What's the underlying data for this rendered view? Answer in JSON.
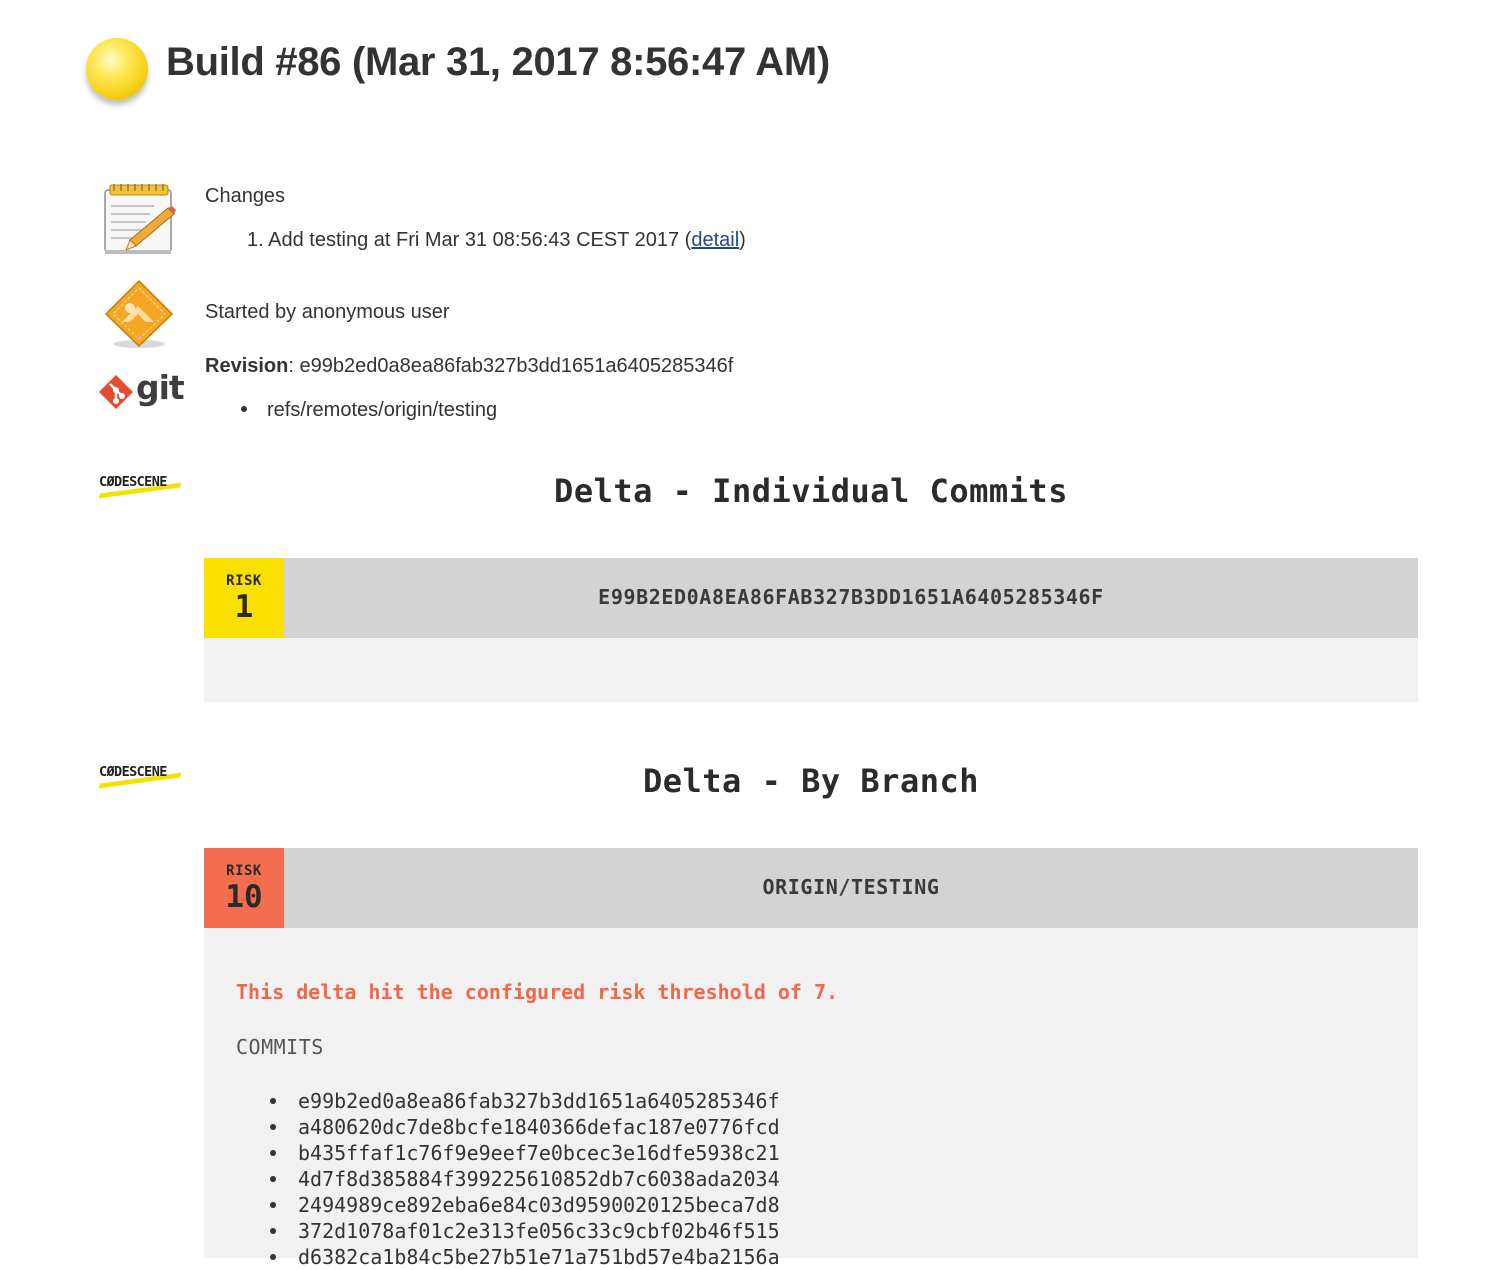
{
  "build": {
    "title": "Build #86 (Mar 31, 2017 8:56:47 AM)",
    "status_color": "#f6cf19"
  },
  "changes": {
    "heading": "Changes",
    "items": [
      {
        "number": "1.",
        "text": "Add testing at Fri Mar 31 08:56:43 CEST 2017",
        "link_label": "detail"
      }
    ]
  },
  "cause": {
    "text": "Started by anonymous user"
  },
  "git": {
    "logo_text": "git",
    "revision_label": "Revision",
    "revision_value": ": e99b2ed0a8ea86fab327b3dd1651a6405285346f",
    "branches": [
      "refs/remotes/origin/testing"
    ]
  },
  "codescene_logo_text": "CØDESCENE",
  "sections": [
    {
      "title": "Delta - Individual Commits",
      "card": {
        "risk_label": "RISK",
        "risk_value": "1",
        "risk_color": "#f9e000",
        "name": "E99B2ED0A8EA86FAB327B3DD1651A6405285346F"
      }
    },
    {
      "title": "Delta - By Branch",
      "card": {
        "risk_label": "RISK",
        "risk_value": "10",
        "risk_color": "#f46d4e",
        "name": "ORIGIN/TESTING",
        "warning": "This delta hit the configured risk threshold of 7.",
        "commits_label": "COMMITS",
        "commits": [
          "e99b2ed0a8ea86fab327b3dd1651a6405285346f",
          "a480620dc7de8bcfe1840366defac187e0776fcd",
          "b435ffaf1c76f9e9eef7e0bcec3e16dfe5938c21",
          "4d7f8d385884f399225610852db7c6038ada2034",
          "2494989ce892eba6e84c03d9590020125beca7d8",
          "372d1078af01c2e313fe056c33c9cbf02b46f515",
          "d6382ca1b84c5be27b51e71a751bd57e4ba2156a"
        ]
      }
    }
  ]
}
